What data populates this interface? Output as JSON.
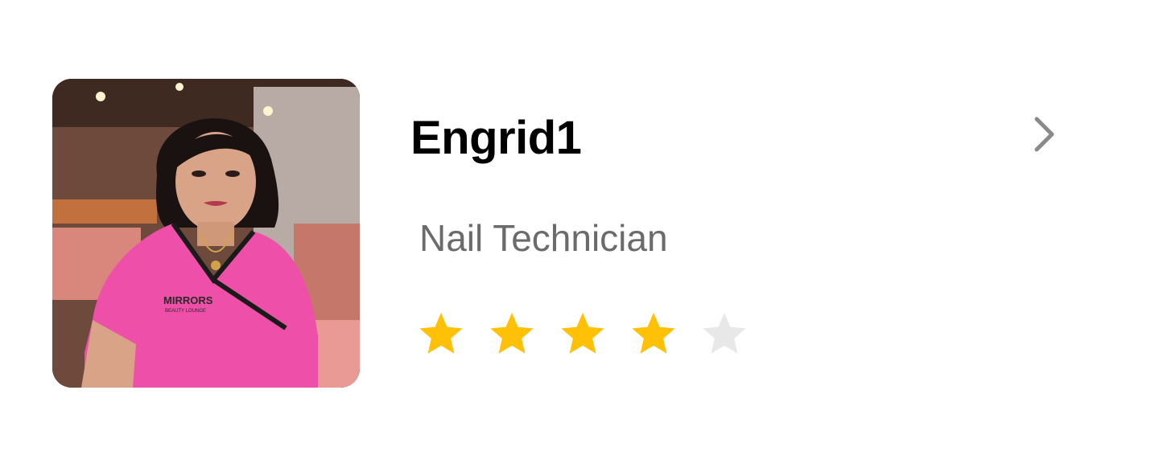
{
  "stylist": {
    "name": "Engrid1",
    "role": "Nail Technician",
    "photo_alt": "Engrid1",
    "uniform_brand": "MIRRORS",
    "uniform_brand_sub": "BEAUTY LOUNGE"
  },
  "rating": {
    "value": 4,
    "max": 5,
    "filled_color": "#FFC107",
    "empty_color": "#E8E8E8"
  },
  "icons": {
    "open": "chevron-right-icon",
    "star": "star-icon"
  }
}
